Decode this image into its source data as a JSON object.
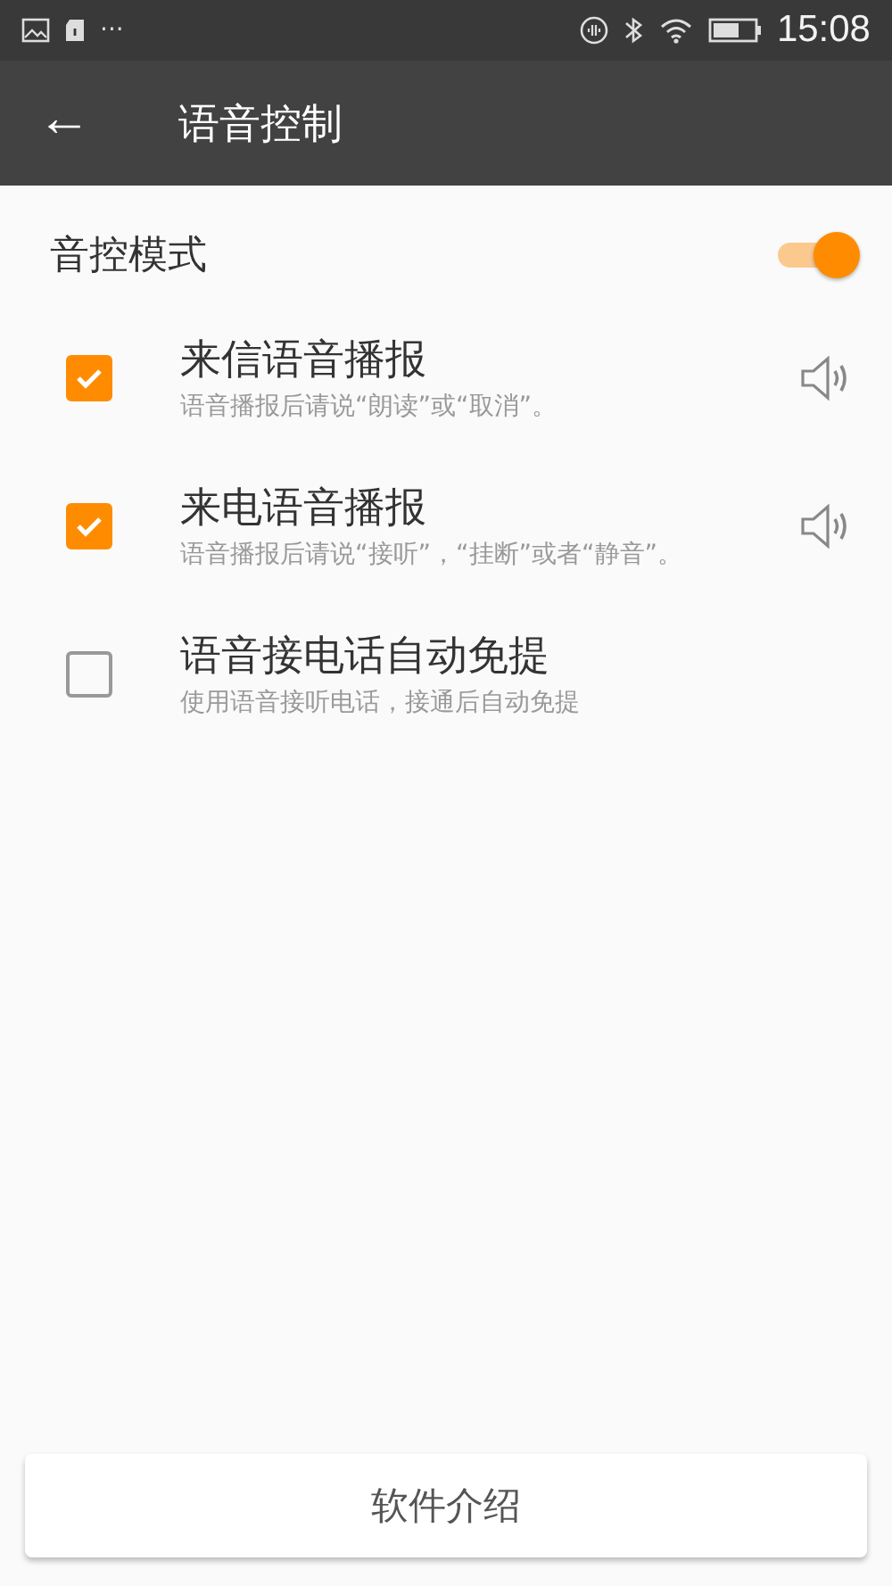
{
  "status_bar": {
    "time": "15:08",
    "dots": "···"
  },
  "app_bar": {
    "back": "←",
    "title": "语音控制"
  },
  "voice_mode": {
    "label": "音控模式",
    "on": true
  },
  "options": [
    {
      "title": "来信语音播报",
      "subtitle": "语音播报后请说“朗读”或“取消”。",
      "checked": true,
      "speaker": true
    },
    {
      "title": "来电语音播报",
      "subtitle": "语音播报后请说“接听”，“挂断”或者“静音”。",
      "checked": true,
      "speaker": true
    },
    {
      "title": "语音接电话自动免提",
      "subtitle": "使用语音接听电话，接通后自动免提",
      "checked": false,
      "speaker": false
    }
  ],
  "footer_button": "软件介绍"
}
